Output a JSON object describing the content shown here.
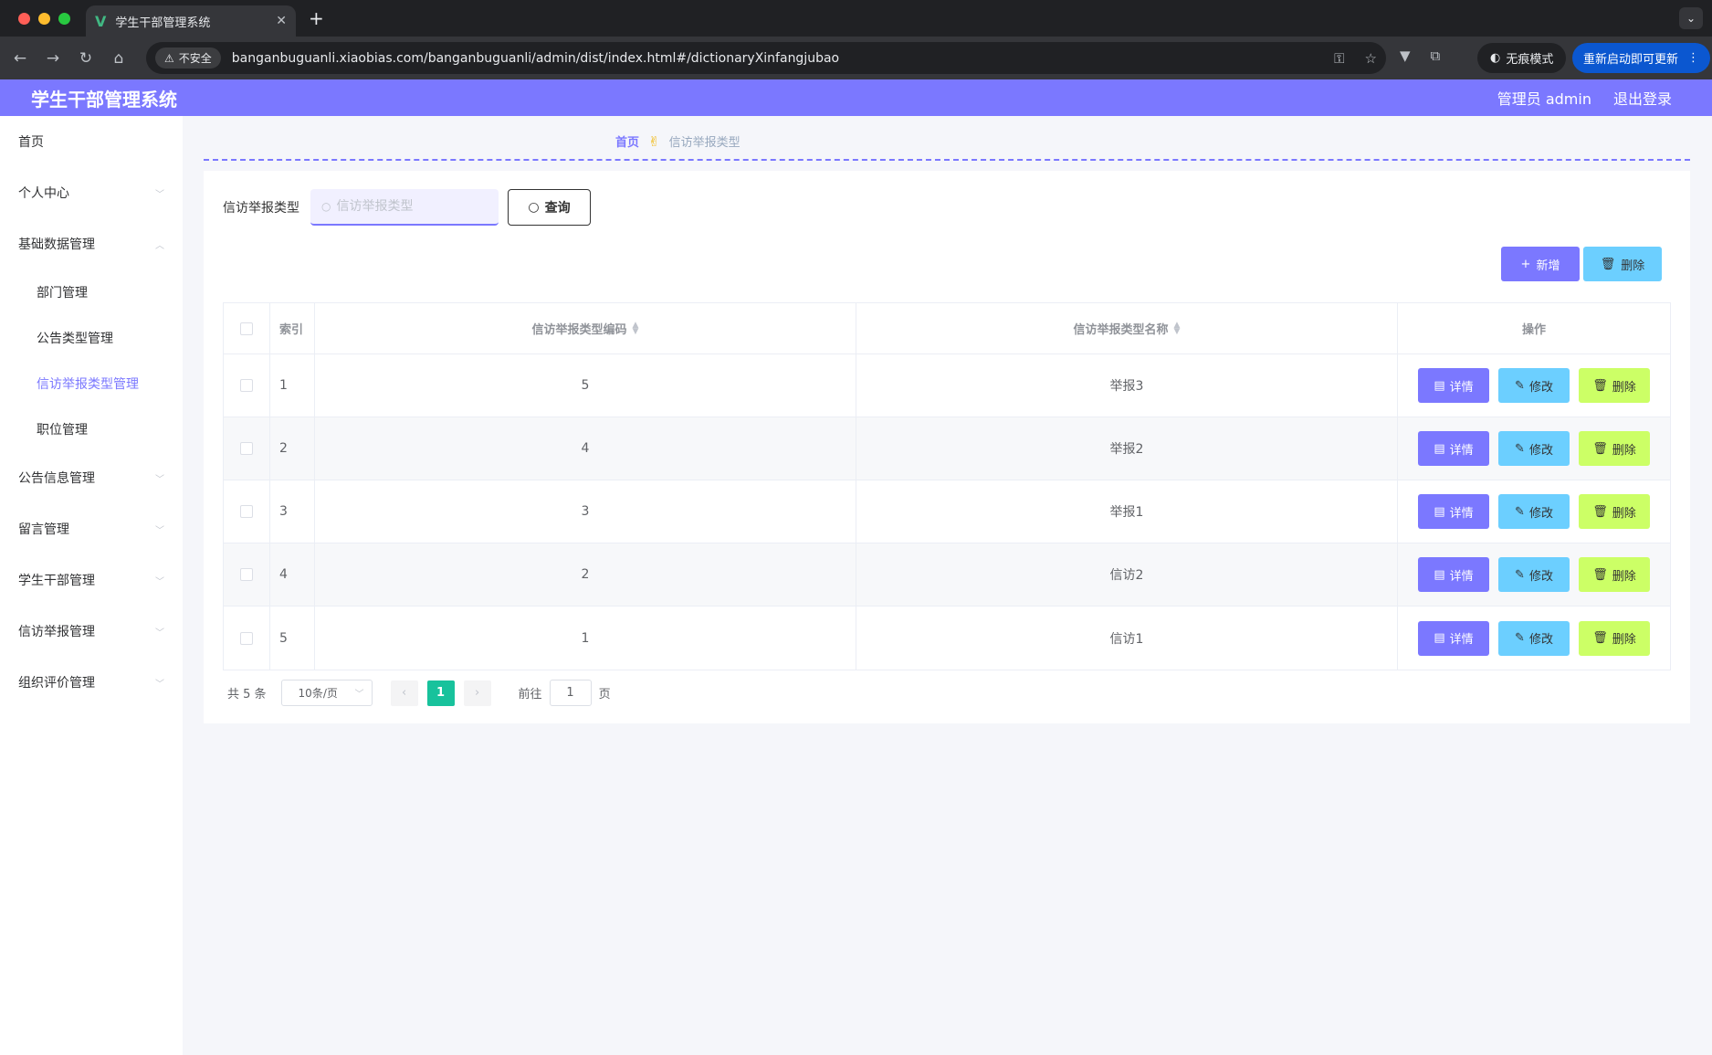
{
  "browser": {
    "tab_title": "学生干部管理系统",
    "new_tab_symbol": "+",
    "insecure_label": "不安全",
    "url": "banganbuguanli.xiaobias.com/banganbuguanli/admin/dist/index.html#/dictionaryXinfangjubao",
    "incognito_label": "无痕模式",
    "update_label": "重新启动即可更新"
  },
  "header": {
    "title": "学生干部管理系统",
    "user_label": "管理员 admin",
    "logout_label": "退出登录"
  },
  "sidebar": {
    "items": [
      {
        "label": "首页"
      },
      {
        "label": "个人中心"
      },
      {
        "label": "基础数据管理"
      },
      {
        "label": "公告信息管理"
      },
      {
        "label": "留言管理"
      },
      {
        "label": "学生干部管理"
      },
      {
        "label": "信访举报管理"
      },
      {
        "label": "组织评价管理"
      }
    ],
    "sub_items": [
      {
        "label": "部门管理"
      },
      {
        "label": "公告类型管理"
      },
      {
        "label": "信访举报类型管理"
      },
      {
        "label": "职位管理"
      }
    ]
  },
  "breadcrumb": {
    "home": "首页",
    "current": "信访举报类型"
  },
  "search": {
    "label": "信访举报类型",
    "placeholder": "信访举报类型",
    "query_label": "查询"
  },
  "actions": {
    "add_label": "新增",
    "delete_label": "删除"
  },
  "table": {
    "headers": {
      "index": "索引",
      "code": "信访举报类型编码",
      "name": "信访举报类型名称",
      "ops": "操作"
    },
    "row_buttons": {
      "detail": "详情",
      "edit": "修改",
      "delete": "删除"
    },
    "rows": [
      {
        "index": "1",
        "code": "5",
        "name": "举报3"
      },
      {
        "index": "2",
        "code": "4",
        "name": "举报2"
      },
      {
        "index": "3",
        "code": "3",
        "name": "举报1"
      },
      {
        "index": "4",
        "code": "2",
        "name": "信访2"
      },
      {
        "index": "5",
        "code": "1",
        "name": "信访1"
      }
    ]
  },
  "pagination": {
    "total": "共 5 条",
    "page_size": "10条/页",
    "current_page": "1",
    "goto_prefix": "前往",
    "goto_value": "1",
    "goto_suffix": "页"
  },
  "colors": {
    "accent": "#7b78ff",
    "info": "#6ccfff",
    "lime": "#ccff66",
    "page_active": "#18c29c"
  }
}
